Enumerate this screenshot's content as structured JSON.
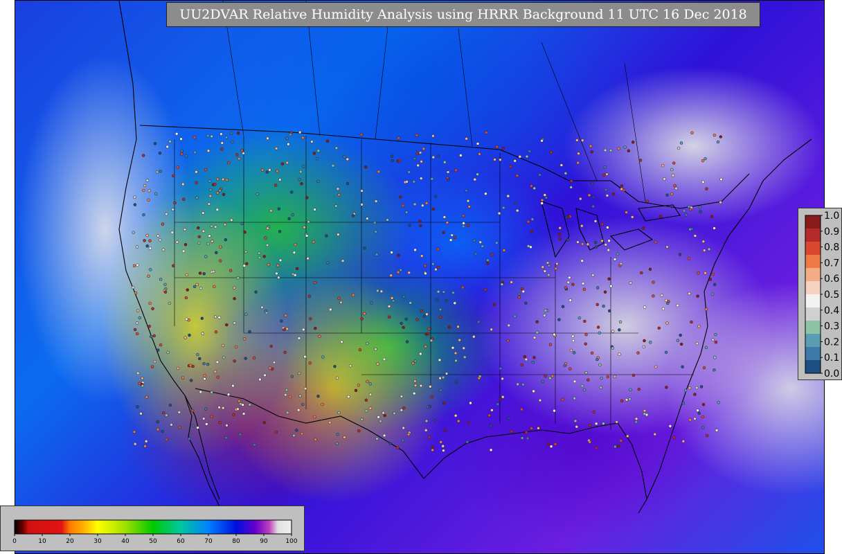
{
  "title": "UU2DVAR Relative Humidity Analysis using HRRR Background 11 UTC 16 Dec 2018",
  "legends": {
    "observation_scale": {
      "labels": [
        "1.0",
        "0.9",
        "0.8",
        "0.7",
        "0.6",
        "0.5",
        "0.4",
        "0.3",
        "0.2",
        "0.1",
        "0.0"
      ],
      "colors": [
        "#8b1a1a",
        "#b52a2a",
        "#d9482f",
        "#ec7a47",
        "#f2ad86",
        "#f5d2bf",
        "#f2f2f2",
        "#d0d0d0",
        "#8fc3a8",
        "#5a9cb3",
        "#3c79a8",
        "#1d4f85"
      ]
    },
    "humidity_scale": {
      "labels": [
        "0",
        "10",
        "20",
        "30",
        "40",
        "50",
        "60",
        "70",
        "80",
        "90",
        "100"
      ],
      "stops": [
        {
          "v": 0,
          "c": "#000000"
        },
        {
          "v": 3,
          "c": "#6e0000"
        },
        {
          "v": 5,
          "c": "#d01010"
        },
        {
          "v": 17,
          "c": "#e31414"
        },
        {
          "v": 20,
          "c": "#ff7a00"
        },
        {
          "v": 25,
          "c": "#ffb000"
        },
        {
          "v": 30,
          "c": "#ffff00"
        },
        {
          "v": 40,
          "c": "#a0e000"
        },
        {
          "v": 50,
          "c": "#00c800"
        },
        {
          "v": 60,
          "c": "#00c8a0"
        },
        {
          "v": 70,
          "c": "#0080ff"
        },
        {
          "v": 80,
          "c": "#0010e0"
        },
        {
          "v": 87,
          "c": "#6600cc"
        },
        {
          "v": 92,
          "c": "#c040c0"
        },
        {
          "v": 95,
          "c": "#e0e0e0"
        },
        {
          "v": 100,
          "c": "#f0f0f0"
        }
      ]
    }
  }
}
